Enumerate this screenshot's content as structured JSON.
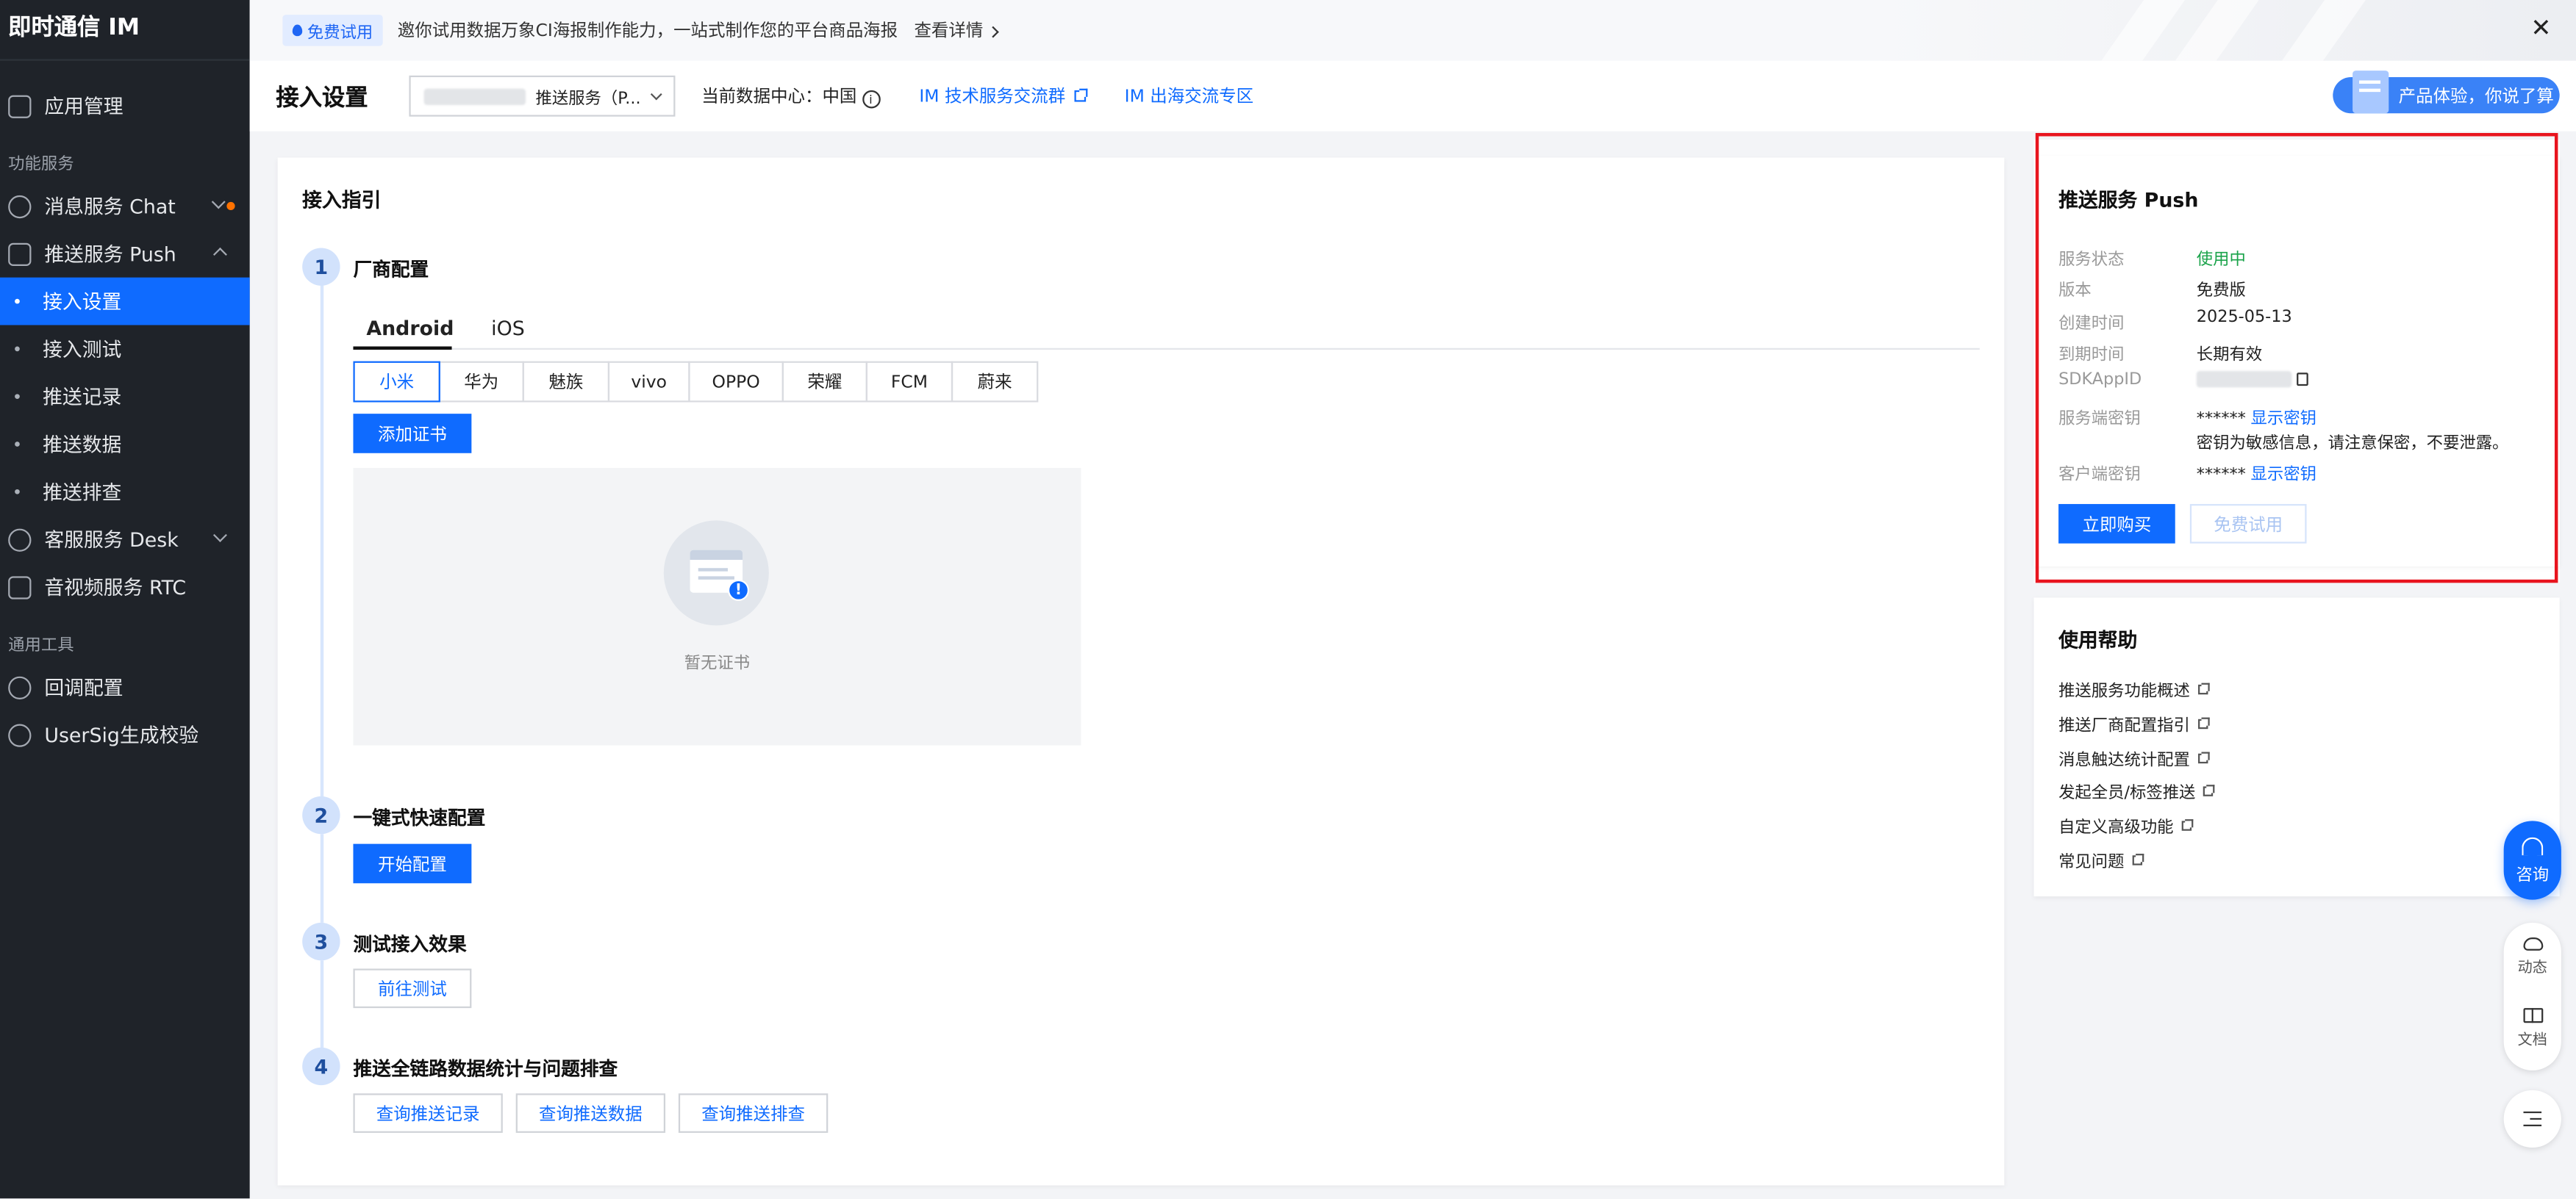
{
  "sidebar": {
    "brand": "即时通信 IM",
    "app_mgmt": "应用管理",
    "section_features": "功能服务",
    "chat": "消息服务 Chat",
    "push": "推送服务 Push",
    "push_sub": [
      "接入设置",
      "接入测试",
      "推送记录",
      "推送数据",
      "推送排查"
    ],
    "desk": "客服服务 Desk",
    "rtc": "音视频服务 RTC",
    "section_tools": "通用工具",
    "callback": "回调配置",
    "usersig": "UserSig生成校验"
  },
  "banner": {
    "tag": "免费试用",
    "text": "邀你试用数据万象CI海报制作能力，一站式制作您的平台商品海报",
    "link": "查看详情",
    "close": "✕"
  },
  "header": {
    "title": "接入设置",
    "app_select_value": "推送服务（P...",
    "data_center": "当前数据中心：中国",
    "link_tech_group": "IM 技术服务交流群",
    "link_overseas": "IM 出海交流专区",
    "feedback": "产品体验，你说了算"
  },
  "guide": {
    "title": "接入指引",
    "step1": {
      "num": "1",
      "title": "厂商配置"
    },
    "platform_tabs": [
      "Android",
      "iOS"
    ],
    "vendors": [
      "小米",
      "华为",
      "魅族",
      "vivo",
      "OPPO",
      "荣耀",
      "FCM",
      "蔚来"
    ],
    "add_cert": "添加证书",
    "empty_text": "暂无证书",
    "step2": {
      "num": "2",
      "title": "一键式快速配置",
      "button": "开始配置"
    },
    "step3": {
      "num": "3",
      "title": "测试接入效果",
      "button": "前往测试"
    },
    "step4": {
      "num": "4",
      "title": "推送全链路数据统计与问题排查",
      "buttons": [
        "查询推送记录",
        "查询推送数据",
        "查询推送排查"
      ]
    }
  },
  "service": {
    "title": "推送服务 Push",
    "status_label": "服务状态",
    "status_value": "使用中",
    "version_label": "版本",
    "version_value": "免费版",
    "created_label": "创建时间",
    "created_value": "2025-05-13",
    "expire_label": "到期时间",
    "expire_value": "长期有效",
    "sdkappid_label": "SDKAppID",
    "server_key_label": "服务端密钥",
    "server_key_mask": "******",
    "show_key": "显示密钥",
    "key_warning": "密钥为敏感信息，请注意保密，不要泄露。",
    "client_key_label": "客户端密钥",
    "client_key_mask": "******",
    "buy": "立即购买",
    "trial": "免费试用",
    "status_color": "#1aa34a"
  },
  "help": {
    "title": "使用帮助",
    "links": [
      "推送服务功能概述",
      "推送厂商配置指引",
      "消息触达统计配置",
      "发起全员/标签推送",
      "自定义高级功能",
      "常见问题"
    ]
  },
  "floating": {
    "consult": "咨询",
    "news": "动态",
    "docs": "文档"
  },
  "colors": {
    "accent": "#0f6bff",
    "sidebar_bg": "#1f2329",
    "highlight": "#e8141e"
  }
}
